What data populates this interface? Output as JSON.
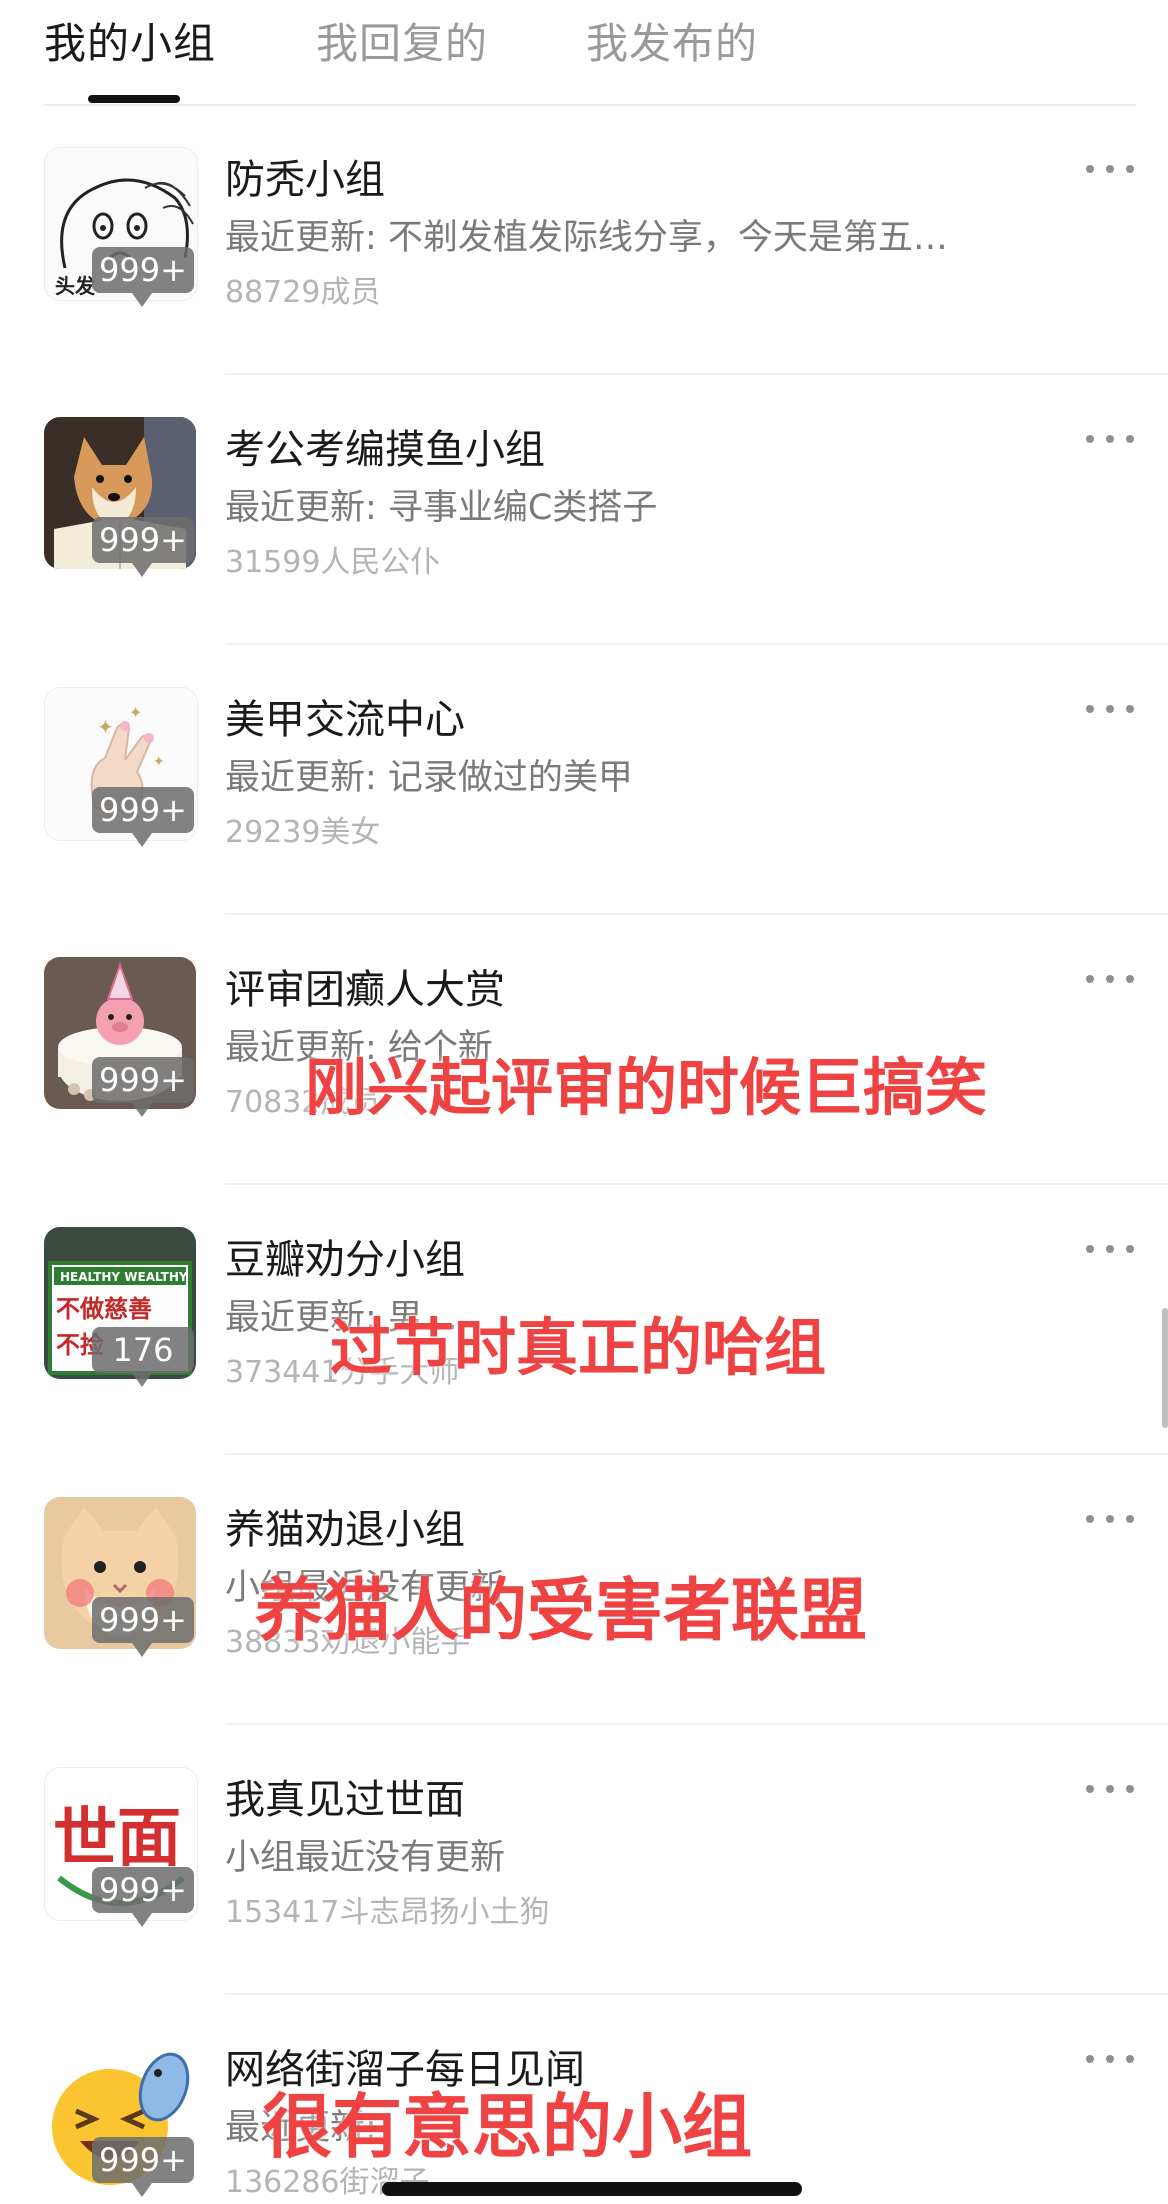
{
  "tabs": [
    {
      "label": "我的小组",
      "active": true
    },
    {
      "label": "我回复的",
      "active": false
    },
    {
      "label": "我发布的",
      "active": false
    }
  ],
  "groups": [
    {
      "title": "防秃小组",
      "recent": "最近更新: 不剃发植发际线分享，今天是第五…",
      "members": "88729成员",
      "badge": "999+",
      "avatar": "bald-cartoon",
      "avatar_caption": "头发"
    },
    {
      "title": "考公考编摸鱼小组",
      "recent": "最近更新: 寻事业编C类搭子",
      "members": "31599人民公仆",
      "badge": "999+",
      "avatar": "shiba-reading"
    },
    {
      "title": "美甲交流中心",
      "recent": "最近更新: 记录做过的美甲",
      "members": "29239美女",
      "badge": "999+",
      "avatar": "manicure-hand"
    },
    {
      "title": "评审团癫人大赏",
      "recent": "最近更新: 给个新",
      "members": "70832成员",
      "badge": "999+",
      "avatar": "pig-cake",
      "overlay": "刚兴起评审的时候巨搞笑"
    },
    {
      "title": "豆瓣劝分小组",
      "recent": "最近更新: 男…",
      "members": "373441分手大师",
      "badge": "176",
      "avatar": "healthy-wealthy-sign",
      "overlay": "过节时真正的哈组",
      "avatar_sign": {
        "line1": "HEALTHY WEALTHY",
        "line2": "不做慈善",
        "line3": "不捡"
      }
    },
    {
      "title": "养猫劝退小组",
      "recent": "小组最近没有更新",
      "members": "38833劝退小能手",
      "badge": "999+",
      "avatar": "blushing-cat",
      "overlay": "养猫人的受害者联盟"
    },
    {
      "title": "我真见过世面",
      "recent": "小组最近没有更新",
      "members": "153417斗志昂扬小土狗",
      "badge": "999+",
      "avatar": "shimian-logo",
      "avatar_text": "世面"
    },
    {
      "title": "网络街溜子每日见闻",
      "recent": "最近更新:",
      "members": "136286街溜子",
      "badge": "999+",
      "avatar": "laughing-emoji-fish",
      "overlay": "很有意思的小组"
    }
  ],
  "colors": {
    "overlay": "#ef4242",
    "badge": "#6e6e6e",
    "active_tab": "#1a1a1a",
    "inactive_tab": "#9a9a9a"
  }
}
